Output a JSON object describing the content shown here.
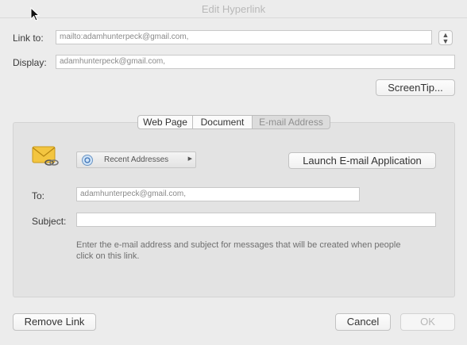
{
  "window": {
    "title": "Edit Hyperlink"
  },
  "top_form": {
    "link_to_label": "Link to:",
    "link_to_value": "mailto:adamhunterpeck@gmail.com,",
    "display_label": "Display:",
    "display_value": "adamhunterpeck@gmail.com,",
    "screentip_label": "ScreenTip..."
  },
  "tabs": [
    {
      "label": "Web Page"
    },
    {
      "label": "Document"
    },
    {
      "label": "E-mail Address"
    }
  ],
  "email_panel": {
    "recent_addresses_label": "Recent Addresses",
    "launch_button_label": "Launch E-mail Application",
    "to_label": "To:",
    "to_value": "adamhunterpeck@gmail.com,",
    "subject_label": "Subject:",
    "subject_value": "",
    "hint_line1": "Enter the e-mail address and subject for messages that will be created when people",
    "hint_line2": "click on this link."
  },
  "footer": {
    "remove_link_label": "Remove Link",
    "cancel_label": "Cancel",
    "ok_label": "OK"
  }
}
